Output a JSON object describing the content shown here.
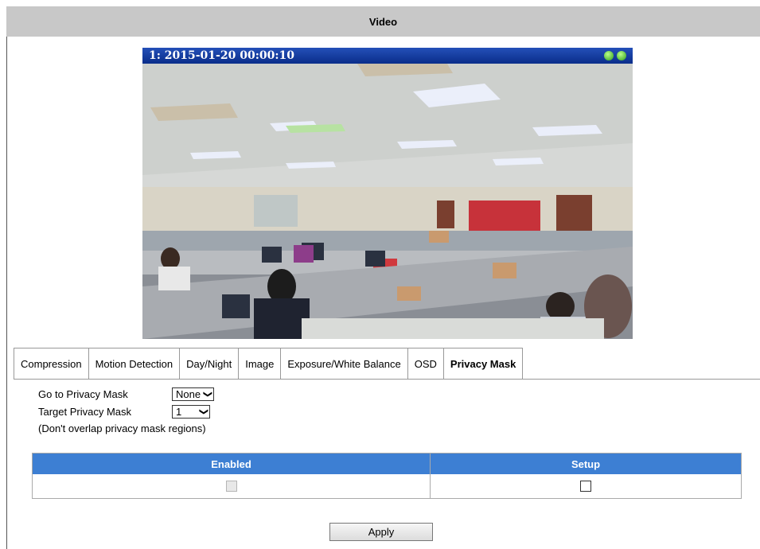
{
  "header": {
    "title": "Video"
  },
  "video": {
    "overlay_text": "1:  2015-01-20 00:00:10",
    "status_icon_1": "green-status-dot-icon",
    "status_icon_2": "green-status-dot-icon"
  },
  "tabs": [
    {
      "label": "Compression"
    },
    {
      "label": "Motion Detection"
    },
    {
      "label": "Day/Night"
    },
    {
      "label": "Image"
    },
    {
      "label": "Exposure/White Balance"
    },
    {
      "label": "OSD"
    },
    {
      "label": "Privacy Mask",
      "active": true
    }
  ],
  "form": {
    "goto_label": "Go to Privacy Mask",
    "goto_value": "None",
    "target_label": "Target Privacy Mask",
    "target_value": "1",
    "note": "(Don't overlap privacy mask regions)"
  },
  "table": {
    "col_enabled": "Enabled",
    "col_setup": "Setup",
    "row": {
      "enabled_checked": false,
      "enabled_disabled": true,
      "setup_checked": false
    }
  },
  "apply_label": "Apply",
  "colors": {
    "header_bg": "#c8c8c8",
    "table_header": "#3d7fd3",
    "overlay_bar": "#0a2d8a"
  }
}
